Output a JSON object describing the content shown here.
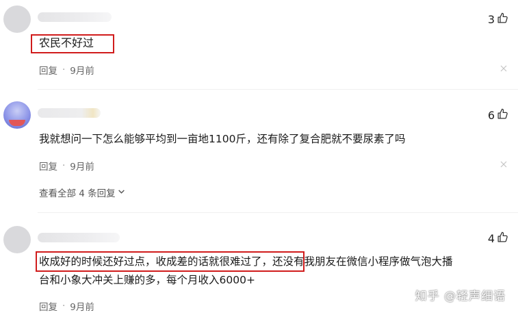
{
  "comments": [
    {
      "likes": "3",
      "text": "农民不好过",
      "reply_label": "回复",
      "time": "9月前"
    },
    {
      "likes": "6",
      "text": "我就想问一下怎么能够平均到一亩地1100斤，还有除了复合肥就不要尿素了吗",
      "reply_label": "回复",
      "time": "9月前",
      "view_all": "查看全部 4 条回复"
    },
    {
      "likes": "4",
      "text_line1": "收成好的时候还好过点，收成差的话就很难过了，还没有我朋友在微信小程序做气泡大播",
      "text_line2": "台和小象大冲关上赚的多，每个月收入6000+",
      "reply_label": "回复",
      "time": "9月前"
    }
  ],
  "meta_separator": "·",
  "watermark": "知乎 @轻声细语",
  "colors": {
    "highlight_box": "#d01b1b",
    "meta_text": "#666666"
  }
}
